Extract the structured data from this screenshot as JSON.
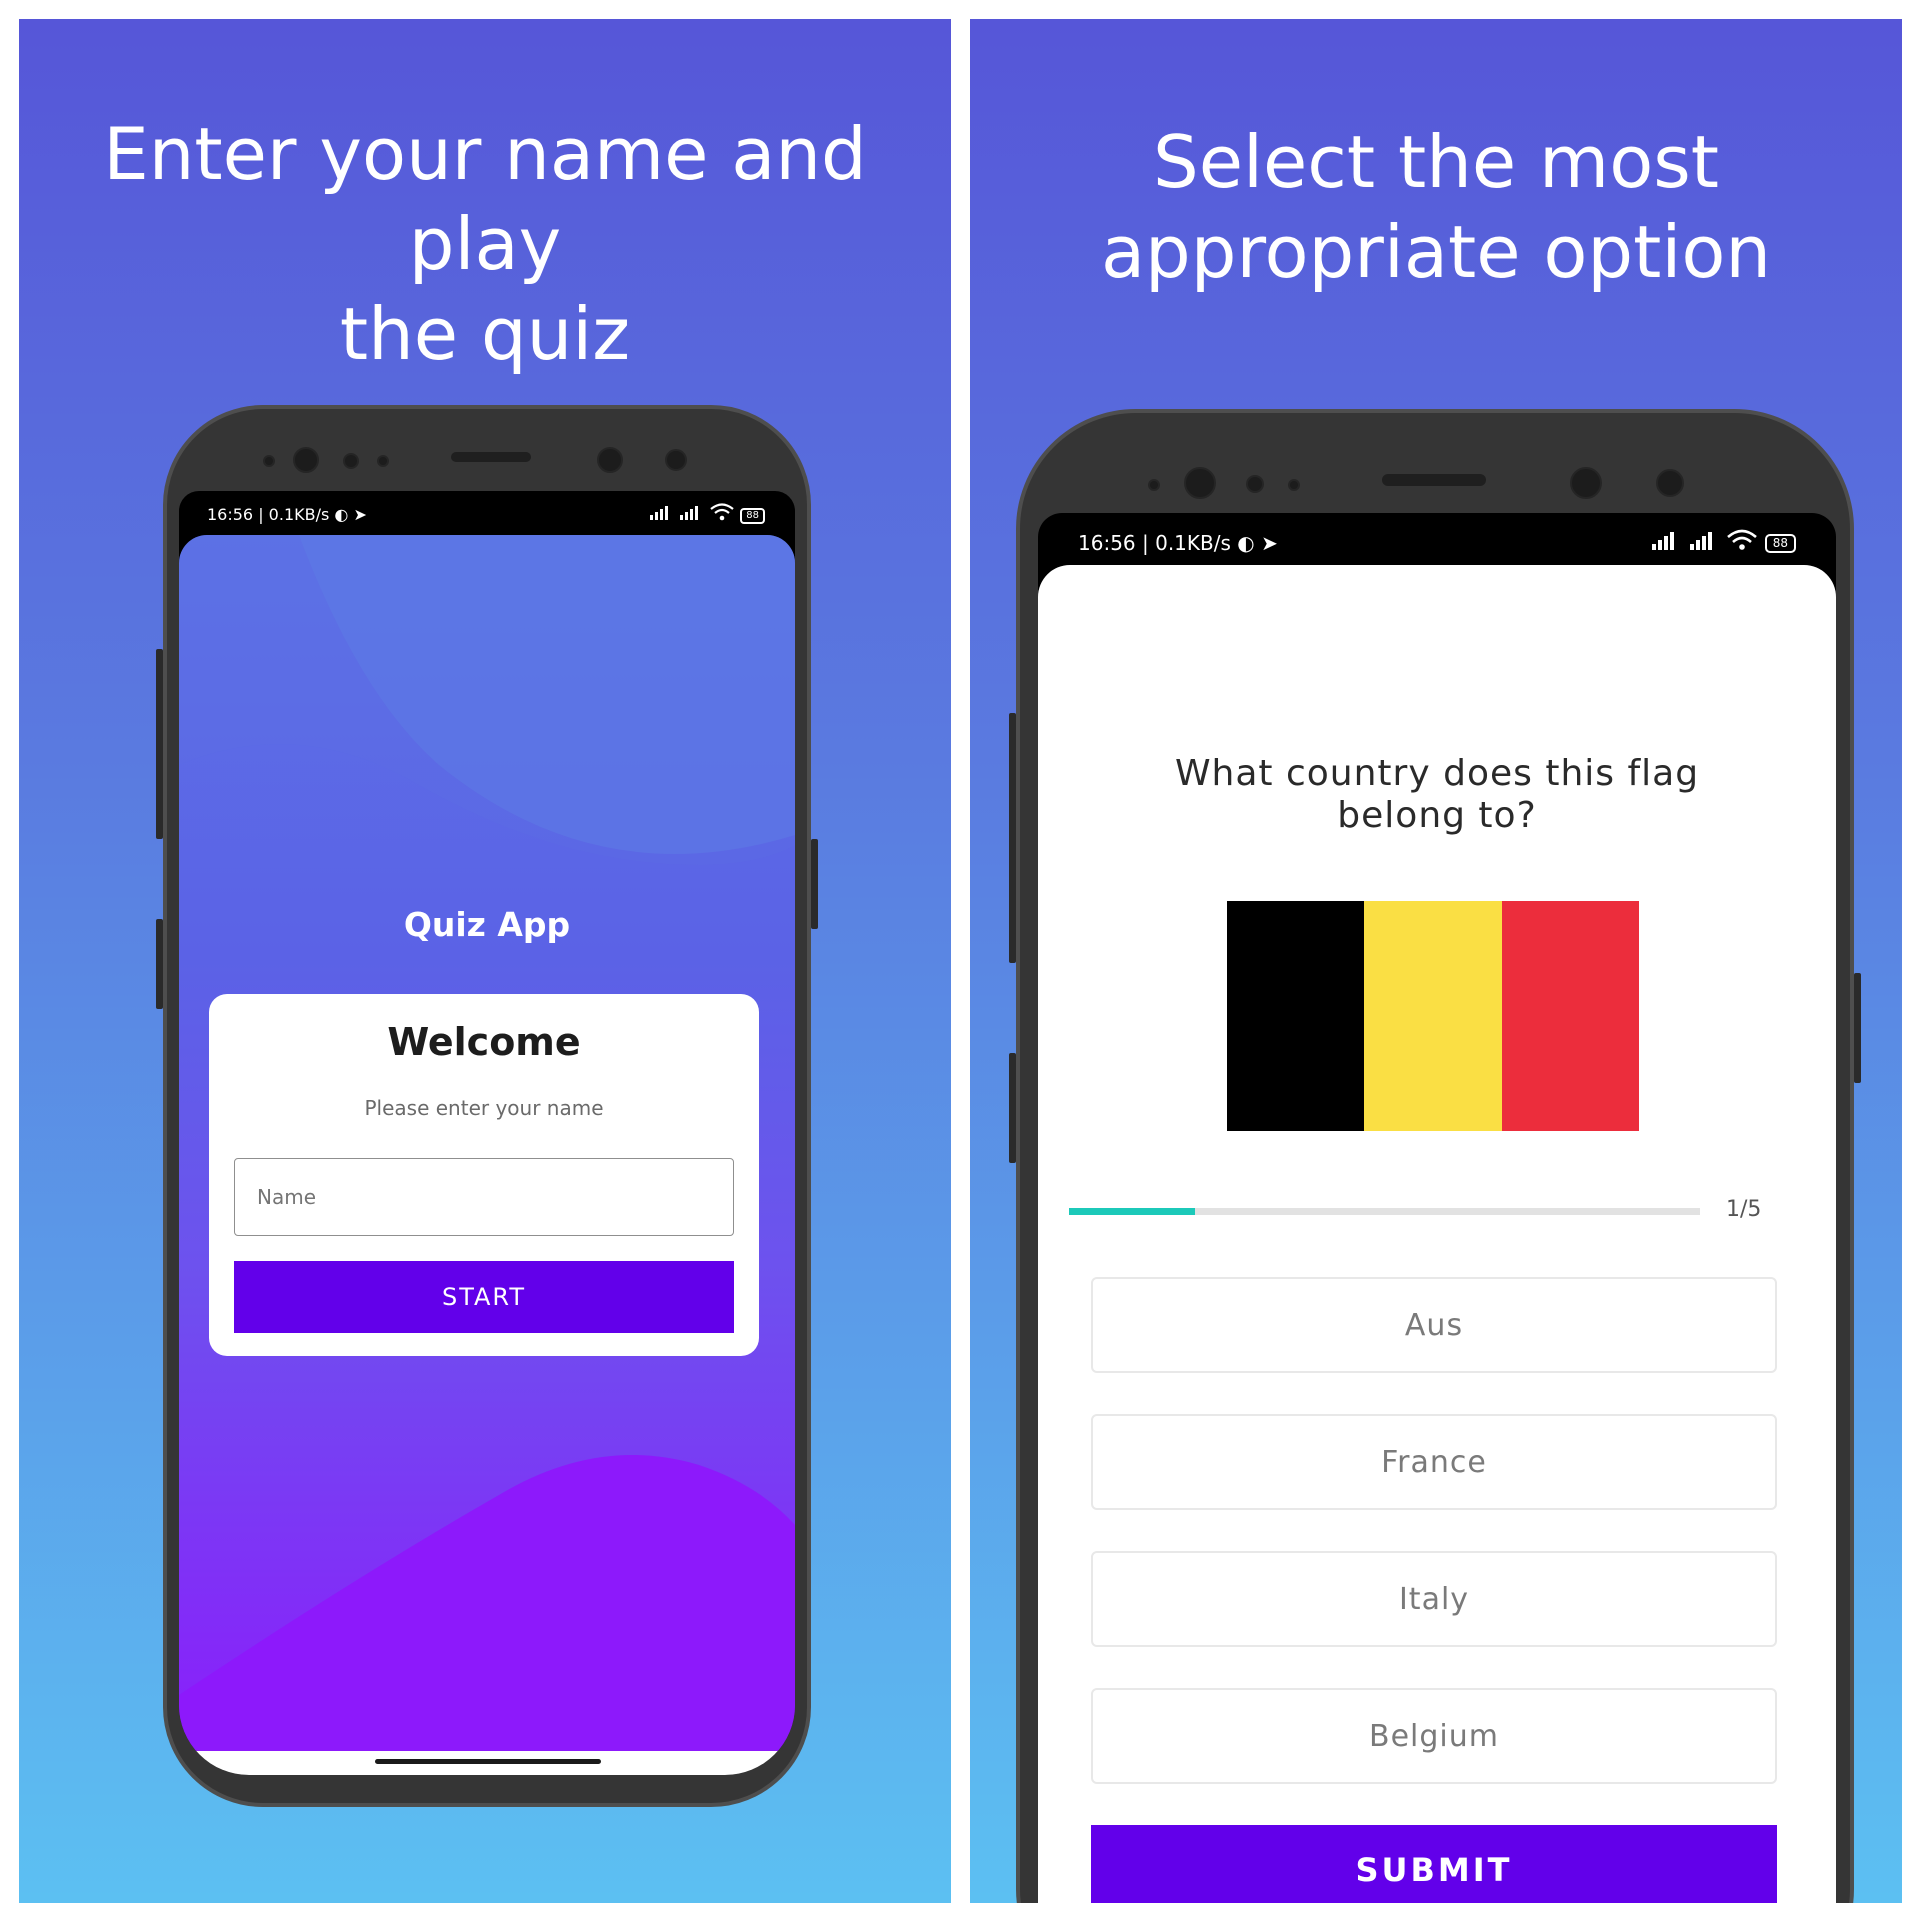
{
  "left_panel": {
    "headline_line1": "Enter your name and play",
    "headline_line2": "the quiz",
    "status": {
      "time": "16:56 | 0.1KB/s",
      "battery": "88"
    },
    "app_title": "Quiz App",
    "card": {
      "title": "Welcome",
      "subtitle": "Please enter your name",
      "name_placeholder": "Name",
      "start_label": "START"
    },
    "colors": {
      "card_bg": "#ffffff",
      "start_button": "#6200ea"
    }
  },
  "right_panel": {
    "headline_line1": "Select the most",
    "headline_line2": "appropriate option",
    "status": {
      "time": "16:56 | 0.1KB/s",
      "battery": "88"
    },
    "question_line1": "What country does this flag",
    "question_line2": "belong to?",
    "flag_colors": [
      "#000000",
      "#fadf44",
      "#ec2d3c"
    ],
    "progress": {
      "label": "1/5",
      "fraction": 0.2,
      "color": "#1cc9b9"
    },
    "options": [
      "Aus",
      "France",
      "Italy",
      "Belgium"
    ],
    "submit_label": "SUBMIT",
    "colors": {
      "submit_button": "#6200ea"
    }
  }
}
